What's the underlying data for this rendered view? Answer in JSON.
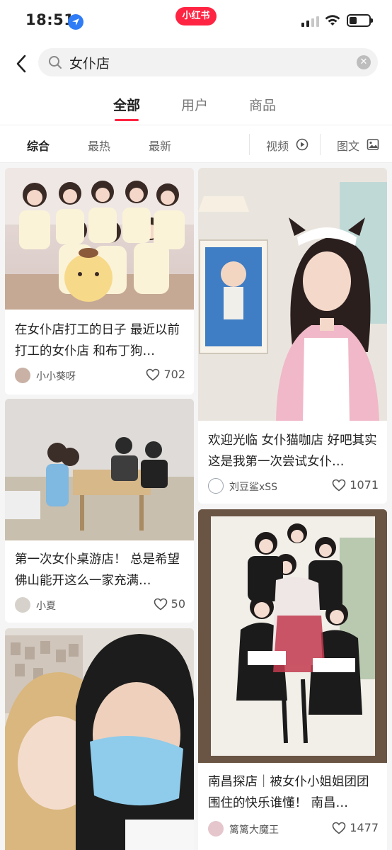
{
  "status_bar": {
    "time": "18:51",
    "brand": "小红书"
  },
  "search": {
    "query": "女仆店"
  },
  "tabs": [
    {
      "label": "全部",
      "active": true
    },
    {
      "label": "用户",
      "active": false
    },
    {
      "label": "商品",
      "active": false
    }
  ],
  "filters": [
    {
      "label": "综合",
      "active": true
    },
    {
      "label": "最热",
      "active": false
    },
    {
      "label": "最新",
      "active": false
    },
    {
      "label": "视频",
      "icon": "play-circle-icon"
    },
    {
      "label": "图文",
      "icon": "image-icon"
    }
  ],
  "posts": [
    {
      "title": "在女仆店打工的日子 最近以前打工的女仆店 和布丁狗…",
      "author": "小小葵呀",
      "likes": "702"
    },
    {
      "title": "欢迎光临 女仆猫咖店 好吧其实这是我第一次尝试女仆…",
      "author": "刘豆鲨xSS",
      "likes": "1071"
    },
    {
      "title": "第一次女仆桌游店！ 总是希望佛山能开这么一家充满…",
      "author": "小夏",
      "likes": "50"
    },
    {
      "title": "南昌探店｜被女仆小姐姐团团围住的快乐谁懂！ 南昌…",
      "author": "篱篱大魔王",
      "likes": "1477"
    },
    {
      "title": "",
      "author": "",
      "likes": ""
    }
  ],
  "colors": {
    "accent": "#ff2442",
    "location": "#2f7cf6"
  }
}
